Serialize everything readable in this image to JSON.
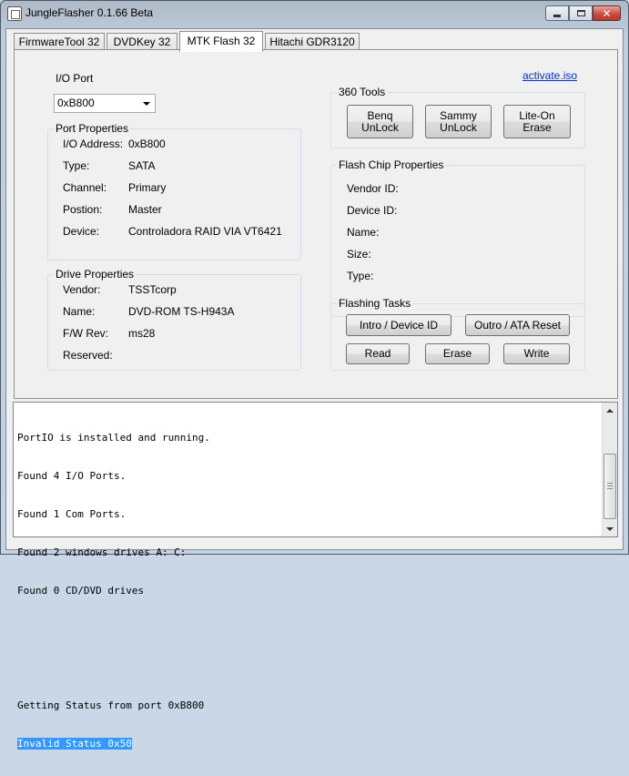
{
  "window": {
    "title": "JungleFlasher 0.1.66 Beta",
    "controls": {
      "minimize": "minimize-icon",
      "maximize": "maximize-icon",
      "close": "close-icon"
    }
  },
  "tabs": [
    {
      "label": "FirmwareTool 32",
      "active": false
    },
    {
      "label": "DVDKey 32",
      "active": false
    },
    {
      "label": "MTK Flash 32",
      "active": true
    },
    {
      "label": "Hitachi GDR3120",
      "active": false
    }
  ],
  "io_port": {
    "label": "I/O Port",
    "selected": "0xB800"
  },
  "activate_link": "activate.iso",
  "port_properties": {
    "title": "Port Properties",
    "rows": [
      {
        "label": "I/O Address:",
        "value": "0xB800"
      },
      {
        "label": "Type:",
        "value": "SATA"
      },
      {
        "label": "Channel:",
        "value": "Primary"
      },
      {
        "label": "Postion:",
        "value": "Master"
      },
      {
        "label": "Device:",
        "value": "Controladora RAID VIA VT6421"
      }
    ]
  },
  "drive_properties": {
    "title": "Drive Properties",
    "rows": [
      {
        "label": "Vendor:",
        "value": "TSSTcorp"
      },
      {
        "label": "Name:",
        "value": "DVD-ROM TS-H943A"
      },
      {
        "label": "F/W Rev:",
        "value": "ms28"
      },
      {
        "label": "Reserved:",
        "value": ""
      }
    ]
  },
  "tools_360": {
    "title": "360 Tools",
    "buttons": [
      {
        "line1": "Benq",
        "line2": "UnLock"
      },
      {
        "line1": "Sammy",
        "line2": "UnLock"
      },
      {
        "line1": "Lite-On Erase",
        "line2": ""
      }
    ]
  },
  "flash_chip": {
    "title": "Flash Chip Properties",
    "rows": [
      "Vendor ID:",
      "Device ID:",
      "Name:",
      "Size:",
      "Type:"
    ]
  },
  "flashing_tasks": {
    "title": "Flashing Tasks",
    "intro_button": "Intro / Device ID",
    "outro_button": "Outro / ATA Reset",
    "read_button": "Read",
    "erase_button": "Erase",
    "write_button": "Write"
  },
  "console": {
    "lines": [
      "PortIO is installed and running.",
      "Found 4 I/O Ports.",
      "Found 1 Com Ports.",
      "Found 2 windows drives A: C:",
      "Found 0 CD/DVD drives",
      "",
      "",
      "Getting Status from port 0xB800",
      "Invalid Status 0x50"
    ],
    "selected_line": 8
  }
}
